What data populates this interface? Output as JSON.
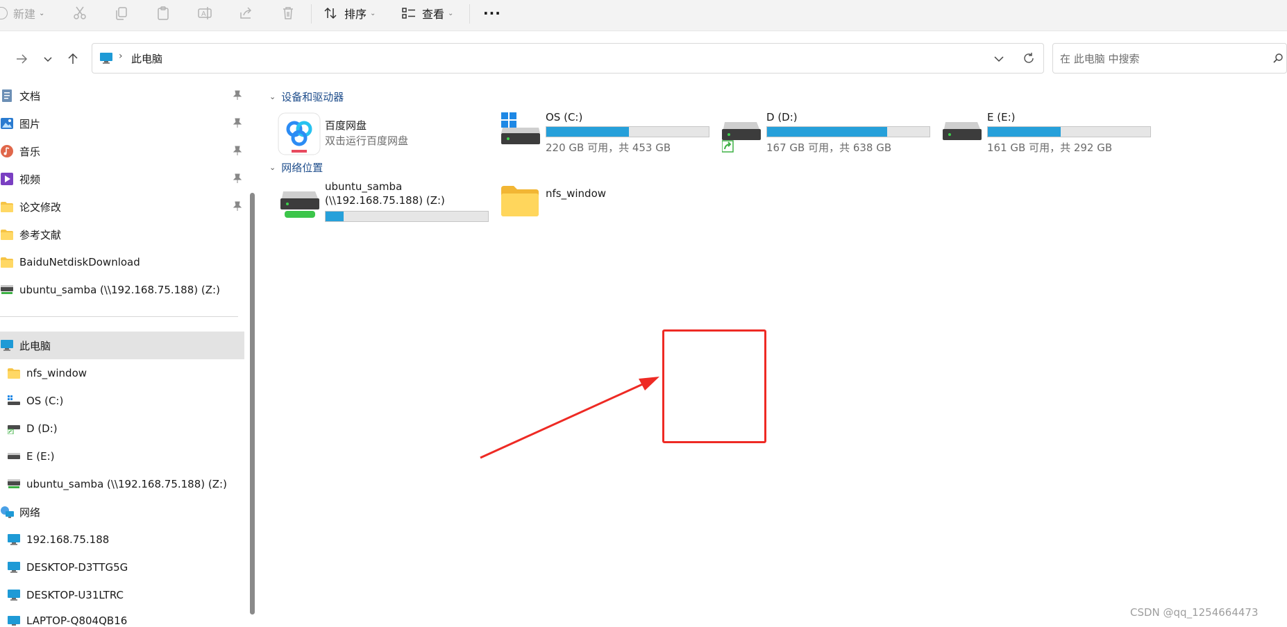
{
  "toolbar": {
    "new_label": "新建",
    "sort_label": "排序",
    "view_label": "查看",
    "more_label": "···"
  },
  "address": {
    "location": "此电脑"
  },
  "search": {
    "placeholder": "在 此电脑 中搜索"
  },
  "sidebar": {
    "quick_access": [
      {
        "label": "文档",
        "icon": "documents-icon",
        "pinned": true
      },
      {
        "label": "图片",
        "icon": "pictures-icon",
        "pinned": true
      },
      {
        "label": "音乐",
        "icon": "music-icon",
        "pinned": true
      },
      {
        "label": "视频",
        "icon": "videos-icon",
        "pinned": true
      },
      {
        "label": "论文修改",
        "icon": "folder-icon",
        "pinned": true
      },
      {
        "label": "参考文献",
        "icon": "folder-icon",
        "pinned": false
      },
      {
        "label": "BaiduNetdiskDownload",
        "icon": "folder-icon",
        "pinned": false
      },
      {
        "label": "ubuntu_samba (\\\\192.168.75.188) (Z:)",
        "icon": "network-drive-icon",
        "pinned": false
      }
    ],
    "this_pc": {
      "label": "此电脑",
      "children": [
        {
          "label": "nfs_window",
          "icon": "folder-icon"
        },
        {
          "label": "OS (C:)",
          "icon": "windows-drive-icon"
        },
        {
          "label": "D (D:)",
          "icon": "shared-drive-icon"
        },
        {
          "label": "E (E:)",
          "icon": "drive-icon"
        },
        {
          "label": "ubuntu_samba (\\\\192.168.75.188) (Z:)",
          "icon": "network-drive-icon"
        }
      ]
    },
    "network": {
      "label": "网络",
      "children": [
        {
          "label": "192.168.75.188",
          "icon": "computer-icon"
        },
        {
          "label": "DESKTOP-D3TTG5G",
          "icon": "computer-icon"
        },
        {
          "label": "DESKTOP-U31LTRC",
          "icon": "computer-icon"
        },
        {
          "label": "LAPTOP-Q804QB16",
          "icon": "computer-icon"
        }
      ]
    }
  },
  "content": {
    "devices_header": "设备和驱动器",
    "network_header": "网络位置",
    "baidu": {
      "name": "百度网盘",
      "sub": "双击运行百度网盘"
    },
    "drives": [
      {
        "name": "OS (C:)",
        "info": "220 GB 可用，共 453 GB",
        "used_fraction": 0.51
      },
      {
        "name": "D (D:)",
        "info": "167 GB 可用，共 638 GB",
        "used_fraction": 0.74
      },
      {
        "name": "E (E:)",
        "info": "161 GB 可用，共 292 GB",
        "used_fraction": 0.45
      }
    ],
    "network_items": [
      {
        "name_line1": "ubuntu_samba",
        "name_line2": "(\\\\192.168.75.188) (Z:)",
        "used_fraction": 0.11
      },
      {
        "name_line1": "nfs_window"
      }
    ]
  },
  "colors": {
    "bar_fill": "#26a0da",
    "annotation_red": "#ee2a24",
    "selected_bg": "#e3e3e3"
  },
  "watermark": "CSDN @qq_1254664473"
}
